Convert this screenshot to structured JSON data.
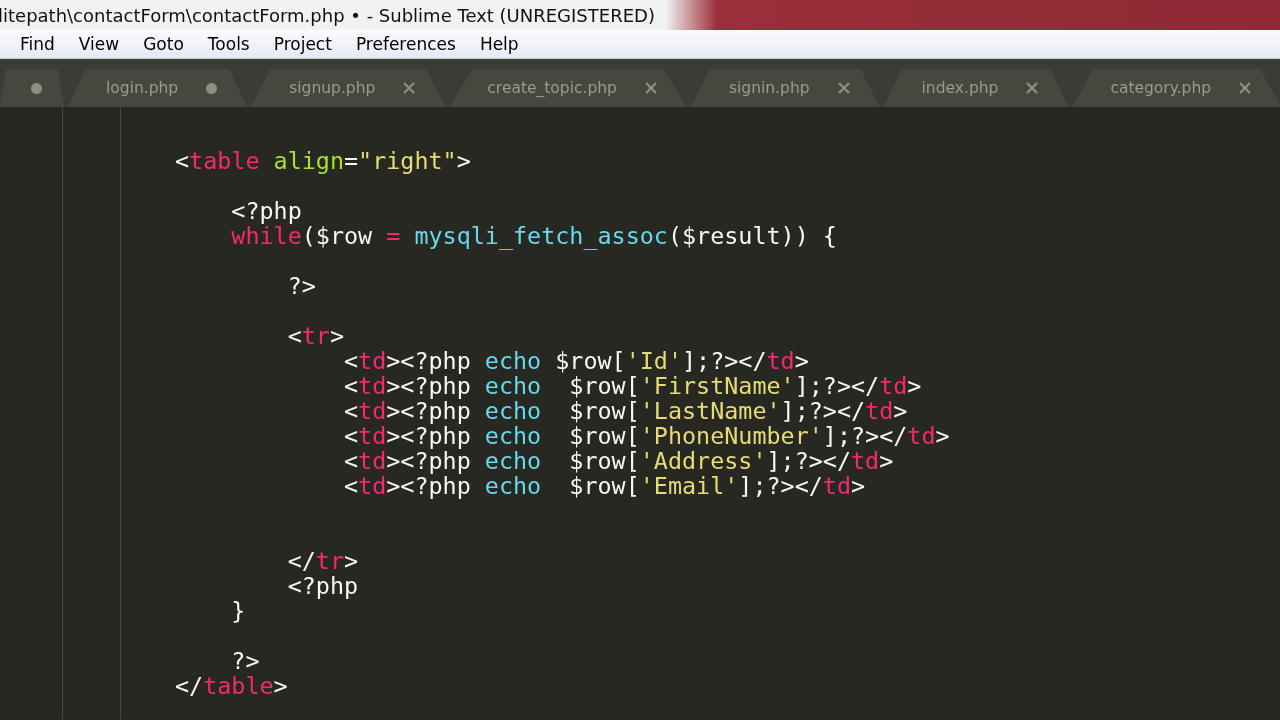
{
  "window": {
    "title": "litepath\\contactForm\\contactForm.php • - Sublime Text (UNREGISTERED)"
  },
  "menu": [
    "Find",
    "View",
    "Goto",
    "Tools",
    "Project",
    "Preferences",
    "Help"
  ],
  "tabs": [
    {
      "modified": true
    },
    {
      "label": "login.php",
      "modified": true
    },
    {
      "label": "signup.php",
      "modified": false
    },
    {
      "label": "create_topic.php",
      "modified": false
    },
    {
      "label": "signin.php",
      "modified": false
    },
    {
      "label": "index.php",
      "modified": false
    },
    {
      "label": "category.php",
      "modified": false
    }
  ],
  "code_lines": [
    {
      "kind": "code",
      "tokens": [
        {
          "kind": "plain",
          "text": "            <"
        },
        {
          "kind": "tag",
          "text": "table"
        },
        {
          "kind": "attr",
          "text": " align"
        },
        {
          "kind": "plain",
          "text": "="
        },
        {
          "kind": "string",
          "text": "\"right\""
        },
        {
          "kind": "plain",
          "text": ">"
        }
      ]
    },
    {
      "kind": "blank"
    },
    {
      "kind": "code",
      "tokens": [
        {
          "kind": "plain",
          "text": "                <?php"
        }
      ]
    },
    {
      "kind": "code",
      "tokens": [
        {
          "kind": "keyword",
          "text": "                while"
        },
        {
          "kind": "plain",
          "text": "($row "
        },
        {
          "kind": "keyword",
          "text": "="
        },
        {
          "kind": "func",
          "text": " mysqli_fetch_assoc"
        },
        {
          "kind": "plain",
          "text": "($result)) {"
        }
      ]
    },
    {
      "kind": "blank"
    },
    {
      "kind": "code",
      "tokens": [
        {
          "kind": "plain",
          "text": "                    ?>"
        }
      ]
    },
    {
      "kind": "blank"
    },
    {
      "kind": "code",
      "tokens": [
        {
          "kind": "plain",
          "text": "                    <"
        },
        {
          "kind": "tag",
          "text": "tr"
        },
        {
          "kind": "plain",
          "text": ">"
        }
      ]
    },
    {
      "kind": "code",
      "tokens": [
        {
          "kind": "plain",
          "text": "                        <"
        },
        {
          "kind": "tag",
          "text": "td"
        },
        {
          "kind": "plain",
          "text": "><?php "
        },
        {
          "kind": "func",
          "text": "echo"
        },
        {
          "kind": "plain",
          "text": " $row["
        },
        {
          "kind": "string",
          "text": "'Id'"
        },
        {
          "kind": "plain",
          "text": "];?></"
        },
        {
          "kind": "tag",
          "text": "td"
        },
        {
          "kind": "plain",
          "text": ">"
        }
      ]
    },
    {
      "kind": "code",
      "tokens": [
        {
          "kind": "plain",
          "text": "                        <"
        },
        {
          "kind": "tag",
          "text": "td"
        },
        {
          "kind": "plain",
          "text": "><?php "
        },
        {
          "kind": "func",
          "text": "echo"
        },
        {
          "kind": "plain",
          "text": "  $row["
        },
        {
          "kind": "string",
          "text": "'FirstName'"
        },
        {
          "kind": "plain",
          "text": "];?></"
        },
        {
          "kind": "tag",
          "text": "td"
        },
        {
          "kind": "plain",
          "text": ">"
        }
      ]
    },
    {
      "kind": "code",
      "tokens": [
        {
          "kind": "plain",
          "text": "                        <"
        },
        {
          "kind": "tag",
          "text": "td"
        },
        {
          "kind": "plain",
          "text": "><?php "
        },
        {
          "kind": "func",
          "text": "echo"
        },
        {
          "kind": "plain",
          "text": "  $row["
        },
        {
          "kind": "string",
          "text": "'LastName'"
        },
        {
          "kind": "plain",
          "text": "];?></"
        },
        {
          "kind": "tag",
          "text": "td"
        },
        {
          "kind": "plain",
          "text": ">"
        }
      ]
    },
    {
      "kind": "code",
      "tokens": [
        {
          "kind": "plain",
          "text": "                        <"
        },
        {
          "kind": "tag",
          "text": "td"
        },
        {
          "kind": "plain",
          "text": "><?php "
        },
        {
          "kind": "func",
          "text": "echo"
        },
        {
          "kind": "plain",
          "text": "  $row["
        },
        {
          "kind": "string",
          "text": "'PhoneNumber'"
        },
        {
          "kind": "plain",
          "text": "];?></"
        },
        {
          "kind": "tag",
          "text": "td"
        },
        {
          "kind": "plain",
          "text": ">"
        }
      ]
    },
    {
      "kind": "code",
      "tokens": [
        {
          "kind": "plain",
          "text": "                        <"
        },
        {
          "kind": "tag",
          "text": "td"
        },
        {
          "kind": "plain",
          "text": "><?php "
        },
        {
          "kind": "func",
          "text": "echo"
        },
        {
          "kind": "plain",
          "text": "  $row["
        },
        {
          "kind": "string",
          "text": "'Address'"
        },
        {
          "kind": "plain",
          "text": "];?></"
        },
        {
          "kind": "tag",
          "text": "td"
        },
        {
          "kind": "plain",
          "text": ">"
        }
      ]
    },
    {
      "kind": "code",
      "tokens": [
        {
          "kind": "plain",
          "text": "                        <"
        },
        {
          "kind": "tag",
          "text": "td"
        },
        {
          "kind": "plain",
          "text": "><?php "
        },
        {
          "kind": "func",
          "text": "echo"
        },
        {
          "kind": "plain",
          "text": "  $row["
        },
        {
          "kind": "string",
          "text": "'Email'"
        },
        {
          "kind": "plain",
          "text": "];?></"
        },
        {
          "kind": "tag",
          "text": "td"
        },
        {
          "kind": "plain",
          "text": ">"
        }
      ]
    },
    {
      "kind": "blank"
    },
    {
      "kind": "blank"
    },
    {
      "kind": "code",
      "tokens": [
        {
          "kind": "plain",
          "text": "                    </"
        },
        {
          "kind": "tag",
          "text": "tr"
        },
        {
          "kind": "plain",
          "text": ">"
        }
      ]
    },
    {
      "kind": "code",
      "tokens": [
        {
          "kind": "plain",
          "text": "                    <?php"
        }
      ]
    },
    {
      "kind": "code",
      "tokens": [
        {
          "kind": "plain",
          "text": "                }"
        }
      ]
    },
    {
      "kind": "blank"
    },
    {
      "kind": "code",
      "tokens": [
        {
          "kind": "plain",
          "text": "                ?>"
        }
      ]
    },
    {
      "kind": "code",
      "tokens": [
        {
          "kind": "plain",
          "text": "            </"
        },
        {
          "kind": "tag",
          "text": "table"
        },
        {
          "kind": "plain",
          "text": ">"
        }
      ]
    }
  ]
}
